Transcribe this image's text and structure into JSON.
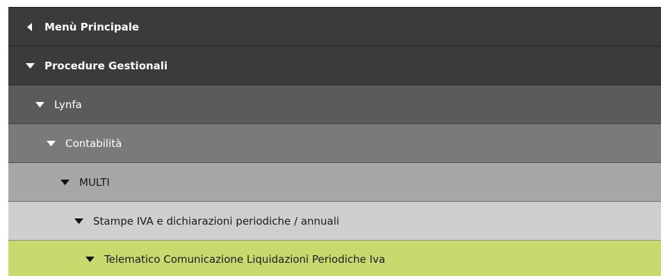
{
  "menu": {
    "back_item": {
      "label": "Menù Principale",
      "icon": "chevron-left-icon"
    },
    "items": [
      {
        "label": "Procedure Gestionali",
        "icon": "caret-down-icon",
        "expanded": true
      },
      {
        "label": "Lynfa",
        "icon": "caret-down-icon",
        "expanded": true
      },
      {
        "label": "Contabilità",
        "icon": "caret-down-icon",
        "expanded": true
      },
      {
        "label": "MULTI",
        "icon": "caret-down-icon",
        "expanded": true
      },
      {
        "label": "Stampe IVA e dichiarazioni periodiche / annuali",
        "icon": "caret-down-icon",
        "expanded": true
      },
      {
        "label": "Telematico Comunicazione Liquidazioni Periodiche Iva",
        "icon": "caret-down-icon",
        "expanded": true,
        "selected": true
      }
    ]
  },
  "colors": {
    "level0": "#3b3b3b",
    "level1": "#3b3b3b",
    "level2": "#5b5b5b",
    "level3": "#7a7a7a",
    "level4": "#a7a7a7",
    "level5": "#cfcfcf",
    "selected": "#c9d96e"
  }
}
